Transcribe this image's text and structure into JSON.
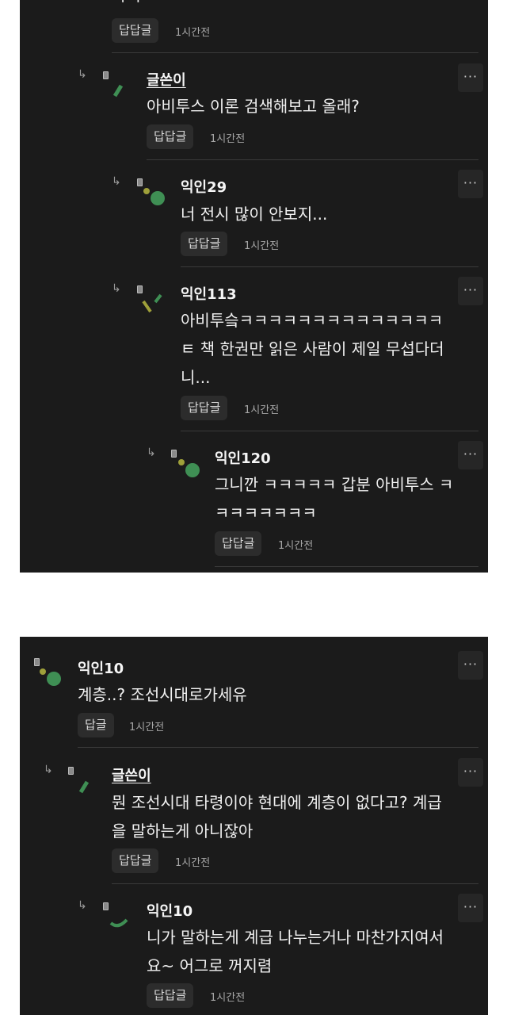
{
  "panel1": {
    "top_cut_text": "가지",
    "top_reply": {
      "reply_label": "답답글",
      "time": "1시간전"
    },
    "comments": [
      {
        "author": "글쓴이",
        "is_op": true,
        "lines": [
          "아비투스 이론 검색해보고 올래?"
        ],
        "reply_label": "답답글",
        "time": "1시간전",
        "more": "···",
        "avatar": "green-slash"
      },
      {
        "author": "익인29",
        "is_op": false,
        "lines": [
          "너 전시 많이 안보지..."
        ],
        "reply_label": "답답글",
        "time": "1시간전",
        "more": "···",
        "avatar": "dots"
      },
      {
        "author": "익인113",
        "is_op": false,
        "lines": [
          "아비투슼ㅋㅋㅋㅋㅋㅋㅋㅋㅋㅋㅋㅋㅋㅋ",
          "ㅌ 책 한권만 읽은 사람이 제일 무섭다더",
          "니..."
        ],
        "reply_label": "답답글",
        "time": "1시간전",
        "more": "···",
        "avatar": "yellow-green-slash"
      },
      {
        "author": "익인120",
        "is_op": false,
        "lines": [
          "그니깐 ㅋㅋㅋㅋㅋ 갑분 아비투스 ㅋ",
          "ㅋㅋㅋㅋㅋㅋㅋ"
        ],
        "reply_label": "답답글",
        "time": "1시간전",
        "more": "···",
        "avatar": "dots"
      }
    ]
  },
  "panel2": {
    "comments": [
      {
        "author": "익인10",
        "is_op": false,
        "lines": [
          "계층..? 조선시대로가세유"
        ],
        "reply_label": "답글",
        "time": "1시간전",
        "more": "···",
        "avatar": "dots"
      },
      {
        "author": "글쓴이",
        "is_op": true,
        "lines": [
          "뭔 조선시대 타령이야 현대에 계층이 없다고? 계급",
          "을 말하는게 아니잖아"
        ],
        "reply_label": "답답글",
        "time": "1시간전",
        "more": "···",
        "avatar": "green-slash"
      },
      {
        "author": "익인10",
        "is_op": false,
        "lines": [
          "니가 말하는게 계급 나누는거나 마찬가지여서",
          "요~ 어그로 꺼지렴"
        ],
        "reply_label": "답답글",
        "time": "1시간전",
        "more": "···",
        "avatar": "green-arc"
      }
    ]
  },
  "colors": {
    "background": "#1b1b1b",
    "page": "#ffffff",
    "avatar_green": "#3f8f54",
    "avatar_yellow": "#9fa03a"
  }
}
